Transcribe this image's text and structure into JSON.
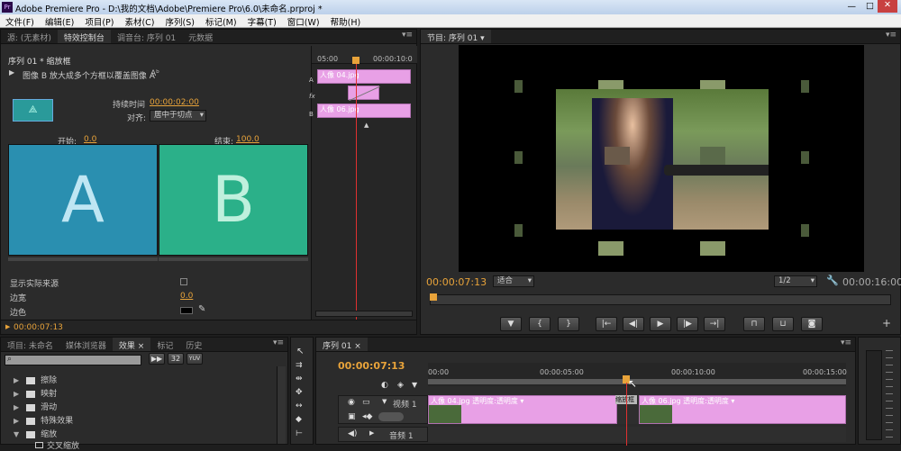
{
  "window": {
    "title": "Adobe Premiere Pro - D:\\我的文档\\Adobe\\Premiere Pro\\6.0\\未命名.prproj *",
    "logo": "Pr"
  },
  "menu": [
    "文件(F)",
    "编辑(E)",
    "项目(P)",
    "素材(C)",
    "序列(S)",
    "标记(M)",
    "字幕(T)",
    "窗口(W)",
    "帮助(H)"
  ],
  "effect_panel": {
    "tabs": [
      "源: (无素材)",
      "特效控制台",
      "调音台: 序列 01",
      "元数据"
    ],
    "sequence_label": "序列 01 * 缩放框",
    "description": "图像 B 放大成多个方框以覆盖图像 A",
    "ab_icon": "Aᵇ",
    "duration_label": "持续时间",
    "duration_value": "00:00:02:00",
    "align_label": "对齐:",
    "align_value": "居中于切点",
    "start_label": "开始:",
    "start_value": "0.0",
    "end_label": "结束:",
    "end_value": "100.0",
    "letter_a": "A",
    "letter_b": "B",
    "show_source_label": "显示实际来源",
    "border_width_label": "边宽",
    "border_width_value": "0.0",
    "border_color_label": "边色",
    "timecode": "00:00:07:13",
    "mini_timeline": {
      "time_start": "05:00",
      "time_end": "00:00:10:0",
      "clip_a": "人像 04.jpg",
      "clip_b": "人像 06.jpg",
      "track_a": "A",
      "track_b": "B"
    }
  },
  "program_monitor": {
    "tab": "节目: 序列 01",
    "timecode": "00:00:07:13",
    "fit_value": "适合",
    "quality_value": "1/2",
    "duration": "00:00:16:00"
  },
  "project_panel": {
    "tabs": [
      "项目: 未命名",
      "媒体浏览器",
      "效果",
      "标记",
      "历史"
    ],
    "search_placeholder": "",
    "buttons": [
      "32",
      "YUV"
    ],
    "tree": [
      "擦除",
      "映射",
      "滑动",
      "特殊效果",
      "缩放",
      "交叉缩放"
    ]
  },
  "timeline": {
    "tab": "序列 01",
    "timecode": "00:00:07:13",
    "ruler": [
      "00:00",
      "00:00:05:00",
      "00:00:10:00",
      "00:00:15:00"
    ],
    "video_track": "视频 1",
    "audio_track": "音频 1",
    "clips": [
      {
        "label": "人像 04.jpg 透明度:透明度 ▾"
      },
      {
        "label": "缩放框"
      },
      {
        "label": "人像 06.jpg 透明度:透明度 ▾"
      }
    ]
  },
  "colors": {
    "accent": "#e8a33a",
    "clip": "#e8a0e6",
    "playhead": "#e03030",
    "a_tile": "#2a8fb0",
    "b_tile": "#2bb089"
  }
}
